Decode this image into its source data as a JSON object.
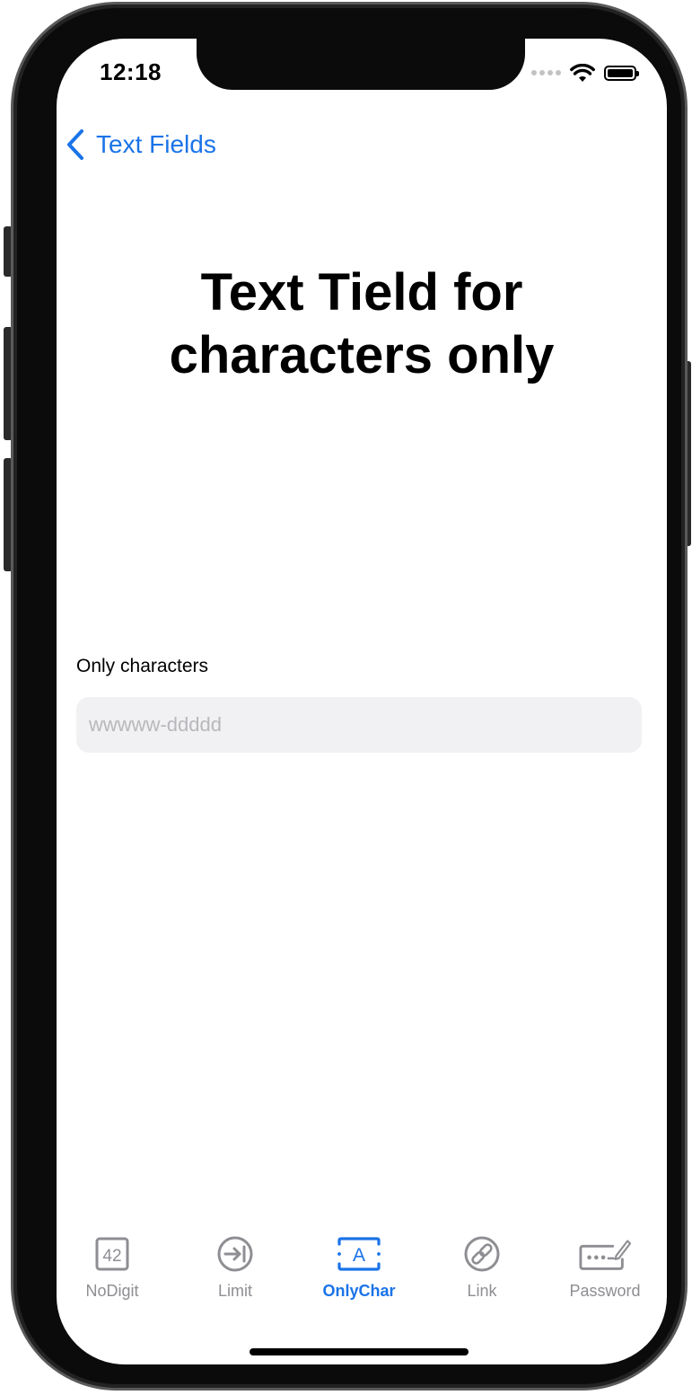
{
  "status_bar": {
    "time": "12:18"
  },
  "nav": {
    "back_label": "Text Fields"
  },
  "page": {
    "title": "Text Tield for characters only"
  },
  "field": {
    "label": "Only characters",
    "placeholder": "wwwww-ddddd",
    "value": ""
  },
  "tabs": [
    {
      "label": "NoDigit",
      "icon": "number-42-icon",
      "icon_text": "42",
      "active": false
    },
    {
      "label": "Limit",
      "icon": "arrow-to-bar-icon",
      "active": false
    },
    {
      "label": "OnlyChar",
      "icon": "letter-a-icon",
      "icon_text": "A",
      "active": true
    },
    {
      "label": "Link",
      "icon": "link-icon",
      "active": false
    },
    {
      "label": "Password",
      "icon": "password-pencil-icon",
      "active": false
    }
  ],
  "colors": {
    "accent": "#1a73e8",
    "inactive": "#8e8e93",
    "field_background": "#f1f1f3"
  }
}
